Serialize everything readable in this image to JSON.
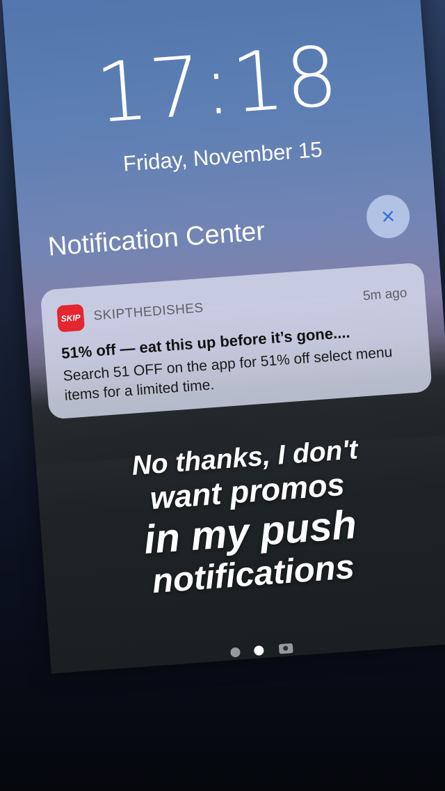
{
  "lockscreen": {
    "time": "17:18",
    "date": "Friday, November 15"
  },
  "notification_center": {
    "title": "Notification Center",
    "close_icon": "×"
  },
  "notification": {
    "app_icon_text": "SKIP",
    "app_name": "SKIPTHEDISHES",
    "time_ago": "5m ago",
    "title": "51% off — eat this up before it’s gone....",
    "body": "Search 51 OFF on the app for 51% off select menu items for a limited time."
  },
  "overlay": {
    "line1": "No thanks, I don't",
    "line2": "want promos",
    "line3": "in my push",
    "line4": "notifications"
  },
  "colors": {
    "app_icon_bg": "#e3262f",
    "close_icon": "#3a6fd8"
  }
}
